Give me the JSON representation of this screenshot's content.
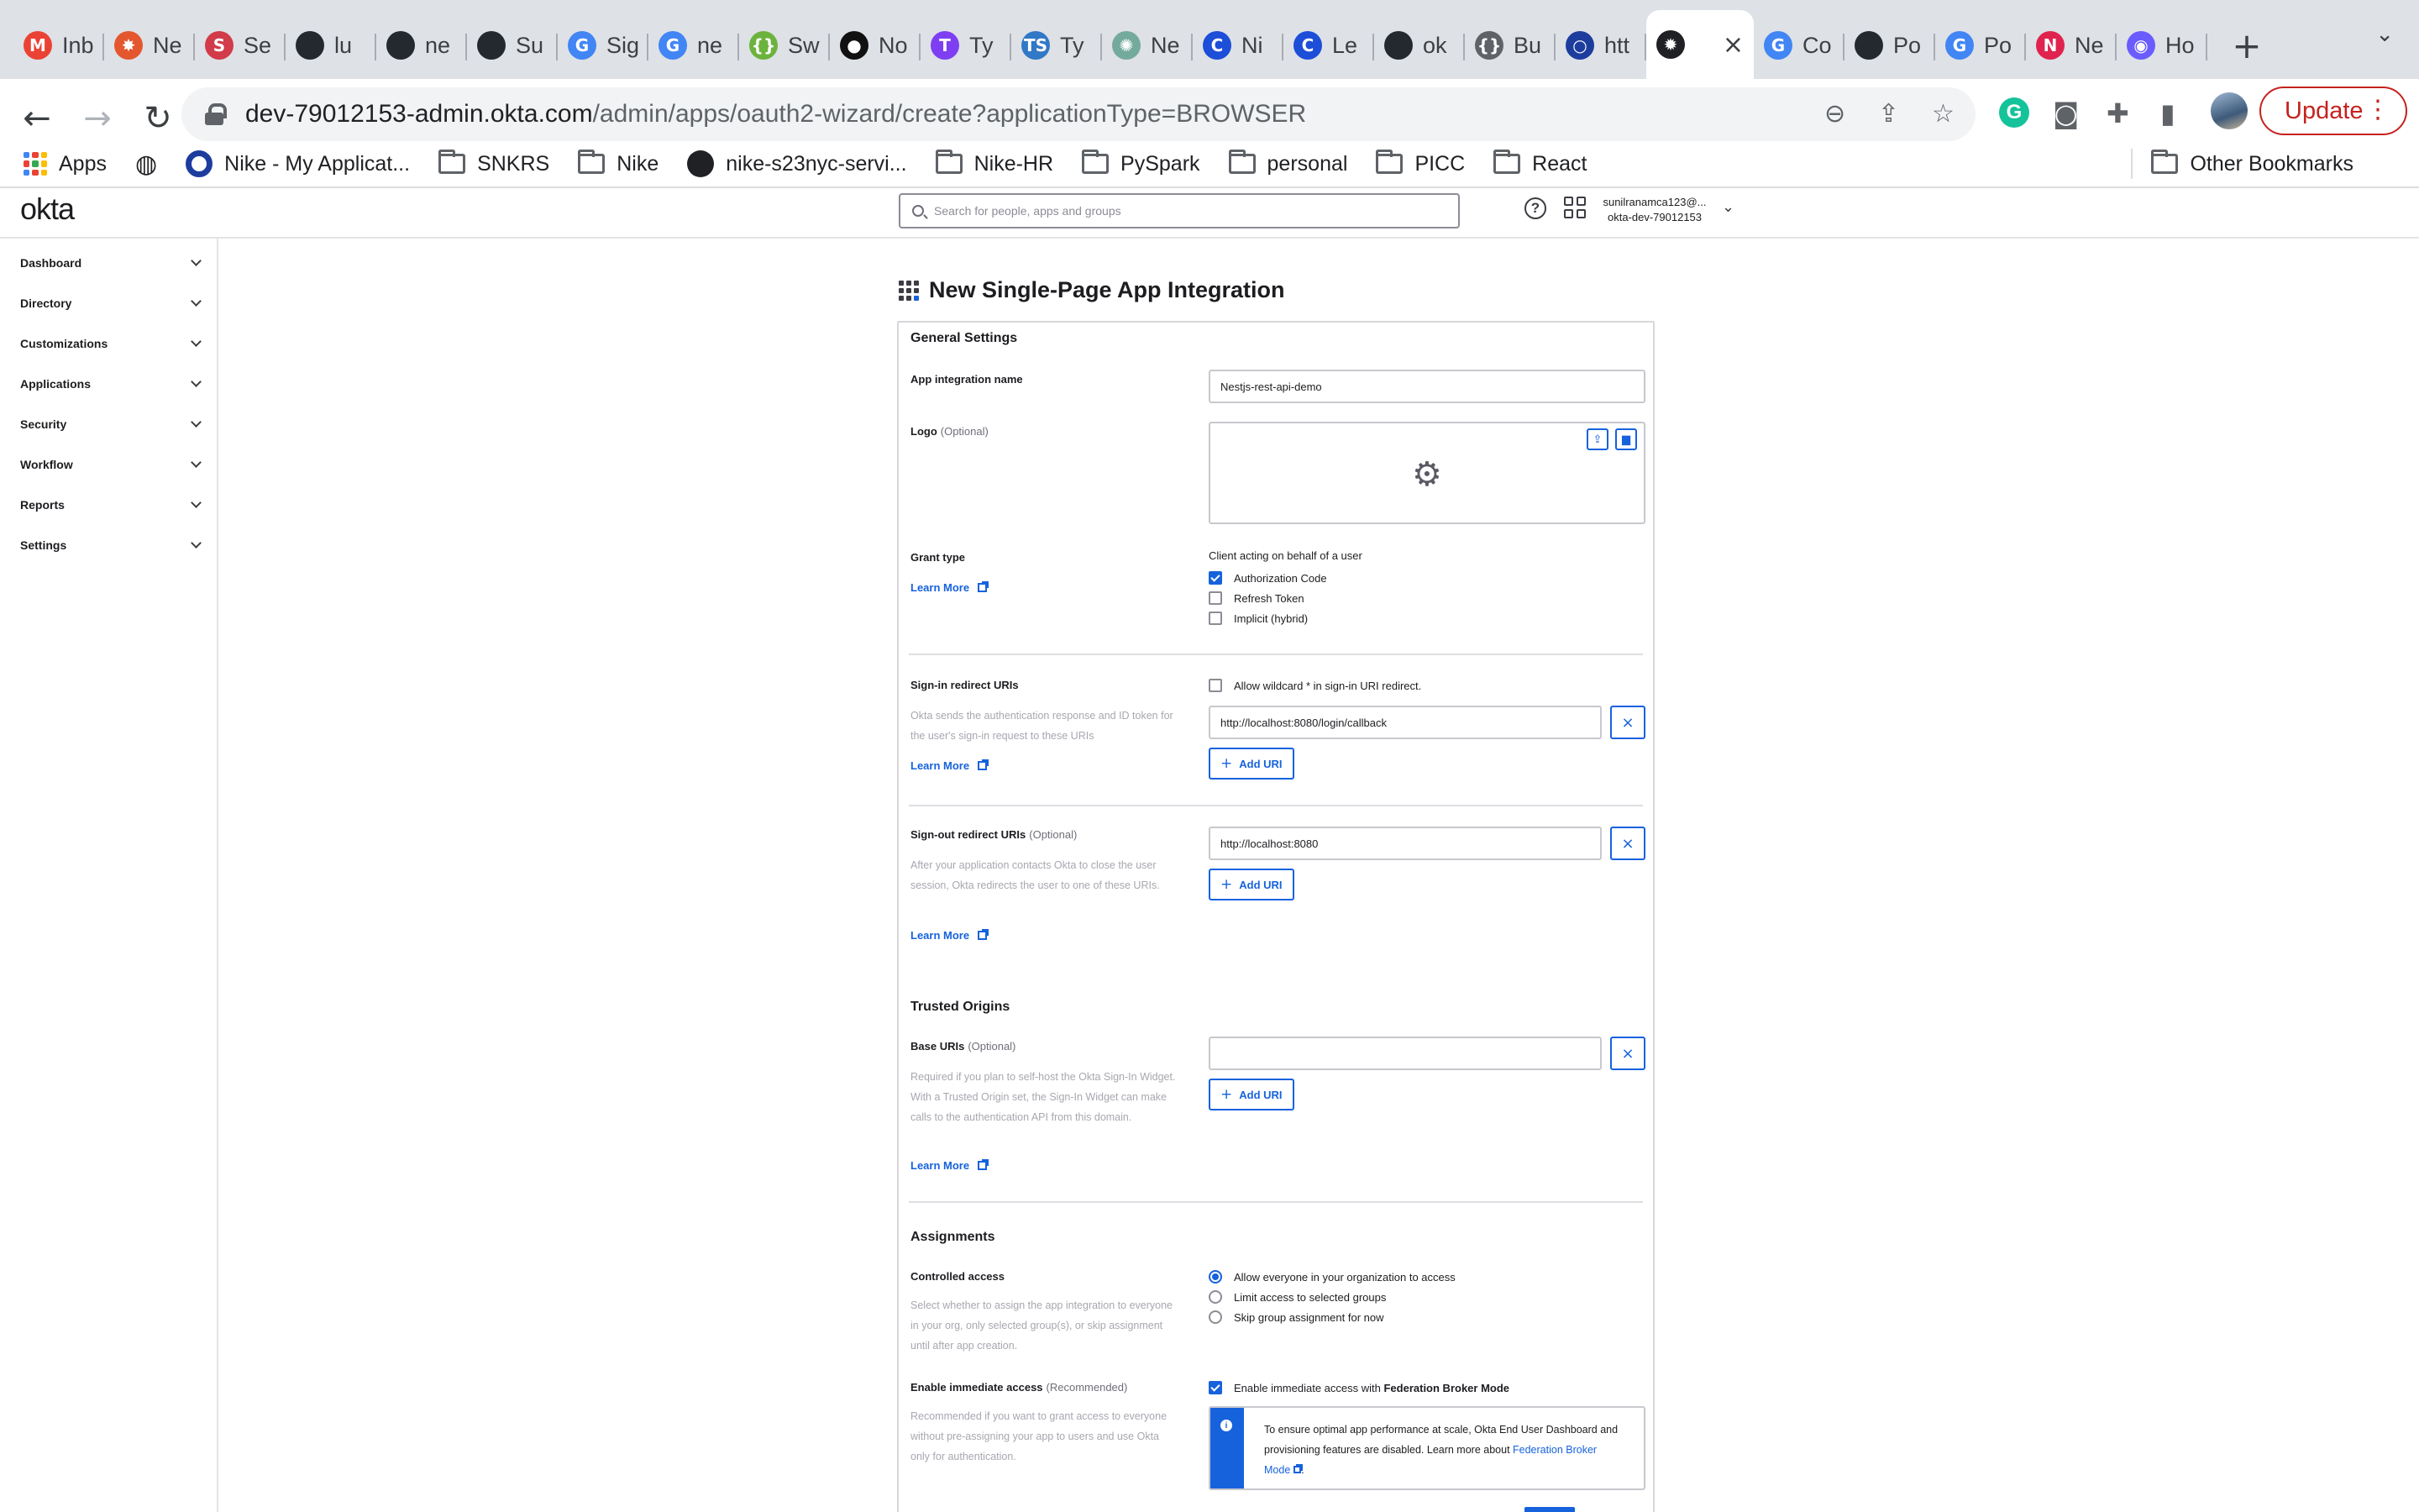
{
  "browser": {
    "tabs": [
      {
        "label": "Inb",
        "icon": "gmail-icon",
        "color": "#ea4335",
        "glyph": "M"
      },
      {
        "label": "Ne",
        "icon": "starburst-icon",
        "color": "#e4572e",
        "glyph": "✸"
      },
      {
        "label": "Se",
        "icon": "bird-icon",
        "color": "#d13b4a",
        "glyph": "S"
      },
      {
        "label": "lu",
        "icon": "github-icon",
        "color": "#24292f",
        "glyph": ""
      },
      {
        "label": "ne",
        "icon": "github-icon",
        "color": "#24292f",
        "glyph": ""
      },
      {
        "label": "Su",
        "icon": "github-icon",
        "color": "#24292f",
        "glyph": ""
      },
      {
        "label": "Sig",
        "icon": "google-icon",
        "color": "#4285f4",
        "glyph": "G"
      },
      {
        "label": "ne",
        "icon": "google-icon",
        "color": "#4285f4",
        "glyph": "G"
      },
      {
        "label": "Sw",
        "icon": "swagger-icon",
        "color": "#6cb33e",
        "glyph": "{}"
      },
      {
        "label": "No",
        "icon": "medium-icon",
        "color": "#111111",
        "glyph": "●"
      },
      {
        "label": "Ty",
        "icon": "typeorm-icon",
        "color": "#7e3ff2",
        "glyph": "T"
      },
      {
        "label": "Ty",
        "icon": "typescript-icon",
        "color": "#3178c6",
        "glyph": "TS"
      },
      {
        "label": "Ne",
        "icon": "chatgpt-icon",
        "color": "#74aa9c",
        "glyph": "✺"
      },
      {
        "label": "Ni",
        "icon": "c-icon",
        "color": "#1d4ed8",
        "glyph": "C"
      },
      {
        "label": "Le",
        "icon": "c-icon",
        "color": "#1d4ed8",
        "glyph": "C"
      },
      {
        "label": "ok",
        "icon": "github-icon",
        "color": "#24292f",
        "glyph": ""
      },
      {
        "label": "Bu",
        "icon": "bracket-icon",
        "color": "#5f6368",
        "glyph": "{}"
      },
      {
        "label": "htt",
        "icon": "okta-ring-icon",
        "color": "#1d3d9e",
        "glyph": "○"
      },
      {
        "label": "",
        "icon": "okta-sun-icon",
        "color": "#202124",
        "glyph": "✹",
        "active": true
      },
      {
        "label": "Co",
        "icon": "google-icon",
        "color": "#4285f4",
        "glyph": "G"
      },
      {
        "label": "Po",
        "icon": "github-icon",
        "color": "#24292f",
        "glyph": ""
      },
      {
        "label": "Po",
        "icon": "google-icon",
        "color": "#4285f4",
        "glyph": "G"
      },
      {
        "label": "Ne",
        "icon": "nestjs-icon",
        "color": "#e0234e",
        "glyph": "N"
      },
      {
        "label": "Ho",
        "icon": "orb-icon",
        "color": "#6a5cff",
        "glyph": "◉"
      }
    ],
    "url_host": "dev-79012153-admin.okta.com",
    "url_path": "/admin/apps/oauth2-wizard/create?applicationType=BROWSER",
    "update_label": "Update",
    "bookmarks": {
      "apps": "Apps",
      "nike_app": "Nike - My Applicat...",
      "snkrs": "SNKRS",
      "nike": "Nike",
      "nike_s23": "nike-s23nyc-servi...",
      "nike_hr": "Nike-HR",
      "pyspark": "PySpark",
      "personal": "personal",
      "picc": "PICC",
      "react": "React",
      "other": "Other Bookmarks"
    }
  },
  "okta": {
    "logo": "okta",
    "search_placeholder": "Search for people, apps and groups",
    "user_email": "sunilranamca123@...",
    "user_org": "okta-dev-79012153"
  },
  "sidebar": {
    "items": [
      "Dashboard",
      "Directory",
      "Customizations",
      "Applications",
      "Security",
      "Workflow",
      "Reports",
      "Settings"
    ]
  },
  "page": {
    "title": "New Single-Page App Integration"
  },
  "form": {
    "general_settings": "General Settings",
    "app_name_label": "App integration name",
    "app_name_value": "Nestjs-rest-api-demo",
    "logo_label": "Logo",
    "optional": "(Optional)",
    "grant_type_label": "Grant type",
    "learn_more": "Learn More",
    "grant_heading": "Client acting on behalf of a user",
    "grants": [
      {
        "label": "Authorization Code",
        "checked": true
      },
      {
        "label": "Refresh Token",
        "checked": false
      },
      {
        "label": "Implicit (hybrid)",
        "checked": false
      }
    ],
    "signin_label": "Sign-in redirect URIs",
    "signin_help": "Okta sends the authentication response and ID token for the user's sign-in request to these URIs",
    "wildcard_label": "Allow wildcard * in sign-in URI redirect.",
    "signin_uri": "http://localhost:8080/login/callback",
    "add_uri": "Add URI",
    "signout_label": "Sign-out redirect URIs",
    "signout_help": "After your application contacts Okta to close the user session, Okta redirects the user to one of these URIs.",
    "signout_uri": "http://localhost:8080",
    "trusted_origins": "Trusted Origins",
    "base_uris_label": "Base URIs",
    "base_uris_help": "Required if you plan to self-host the Okta Sign-In Widget. With a Trusted Origin set, the Sign-In Widget can make calls to the authentication API from this domain.",
    "base_uri_value": "",
    "assignments": "Assignments",
    "controlled_access_label": "Controlled access",
    "controlled_access_help": "Select whether to assign the app integration to everyone in your org, only selected group(s), or skip assignment until after app creation.",
    "access_options": [
      {
        "label": "Allow everyone in your organization to access",
        "selected": true
      },
      {
        "label": "Limit access to selected groups",
        "selected": false
      },
      {
        "label": "Skip group assignment for now",
        "selected": false
      }
    ],
    "immediate_label": "Enable immediate access",
    "recommended": "(Recommended)",
    "immediate_help": "Recommended if you want to grant access to everyone without pre-assigning your app to users and use Okta only for authentication.",
    "immediate_cb_prefix": "Enable immediate access with ",
    "immediate_cb_bold": "Federation Broker Mode",
    "fed_text": "To ensure optimal app performance at scale, Okta End User Dashboard and provisioning features are disabled. Learn more about ",
    "fed_link": "Federation Broker Mode",
    "fed_end": "."
  },
  "colors": {
    "okta_blue": "#1662dd",
    "update_red": "#c5221f"
  }
}
